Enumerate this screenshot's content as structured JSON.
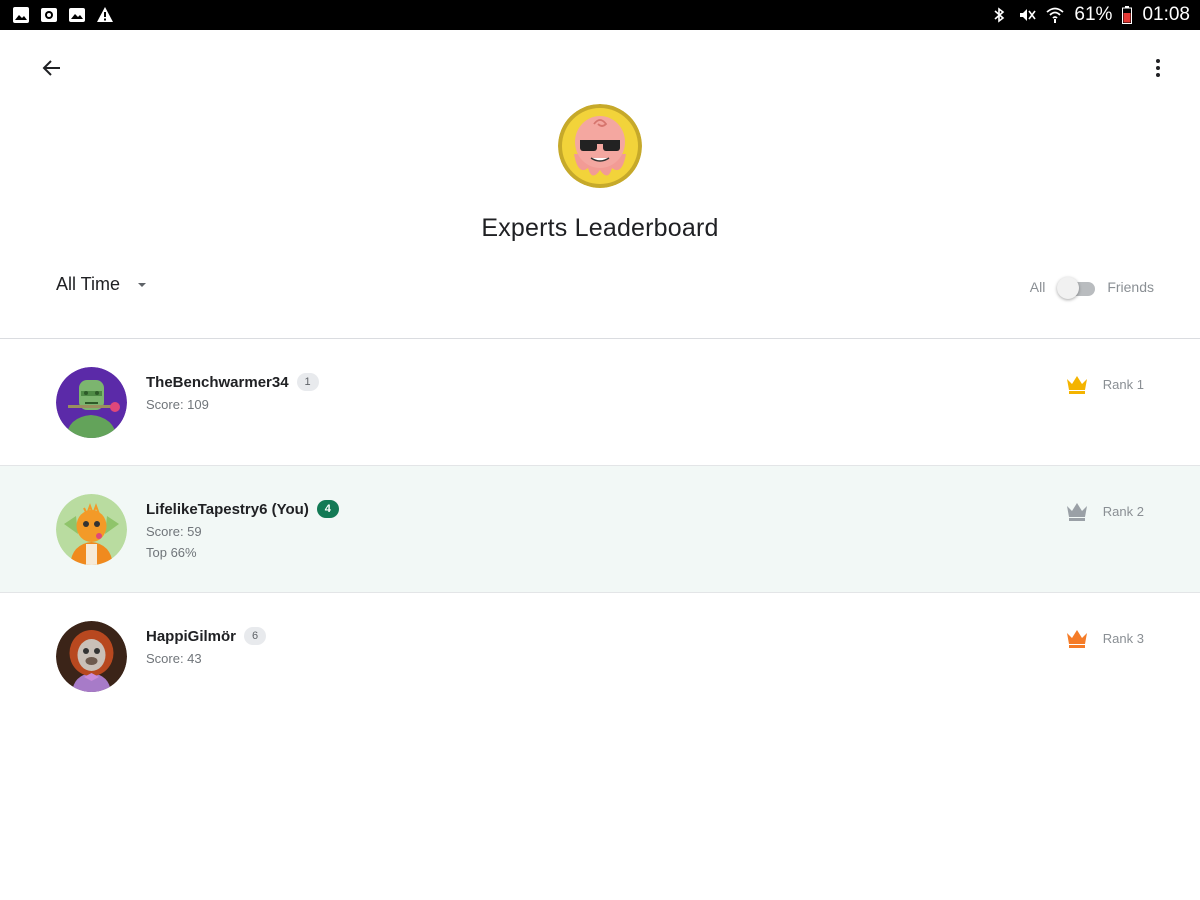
{
  "status_bar": {
    "battery": "61%",
    "time": "01:08"
  },
  "header": {
    "title": "Experts Leaderboard"
  },
  "filter": {
    "time_range": "All Time",
    "toggle_left": "All",
    "toggle_right": "Friends"
  },
  "leaderboard": [
    {
      "name": "TheBenchwarmer34",
      "level": "1",
      "score": "Score: 109",
      "rank": "Rank 1",
      "crown_color": "#f4b400",
      "is_you": false
    },
    {
      "name": "LifelikeTapestry6 (You)",
      "level": "4",
      "score": "Score: 59",
      "top": "Top 66%",
      "rank": "Rank 2",
      "crown_color": "#9aa0a6",
      "is_you": true
    },
    {
      "name": "HappiGilmör",
      "level": "6",
      "score": "Score: 43",
      "rank": "Rank 3",
      "crown_color": "#f57c28",
      "is_you": false
    }
  ],
  "colors": {
    "accent_green": "#137a55",
    "highlight_row": "#f2f8f6"
  }
}
